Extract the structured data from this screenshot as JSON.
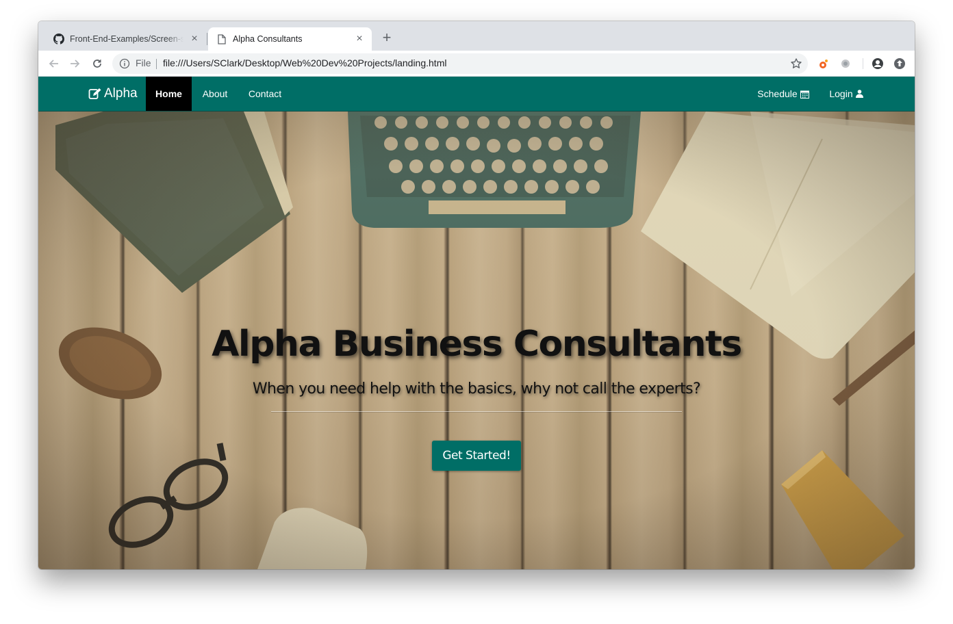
{
  "browser": {
    "tabs": [
      {
        "title": "Front-End-Examples/Screen-s",
        "icon": "github-icon",
        "active": false
      },
      {
        "title": "Alpha Consultants",
        "icon": "document-icon",
        "active": true
      }
    ],
    "close_glyph": "×",
    "new_tab_glyph": "+",
    "address": {
      "scheme_label": "File",
      "url": "file:///Users/SClark/Desktop/Web%20Dev%20Projects/landing.html"
    }
  },
  "site": {
    "brand": "Alpha",
    "nav": {
      "home": "Home",
      "about": "About",
      "contact": "Contact",
      "schedule": "Schedule",
      "login": "Login"
    },
    "hero": {
      "title": "Alpha Business Consultants",
      "subtitle": "When you need help with the basics, why not call the experts?",
      "cta": "Get Started!"
    }
  },
  "colors": {
    "navbar": "#006e66",
    "active_nav": "#000000",
    "cta": "#006e66",
    "tabstrip": "#dee1e6"
  }
}
